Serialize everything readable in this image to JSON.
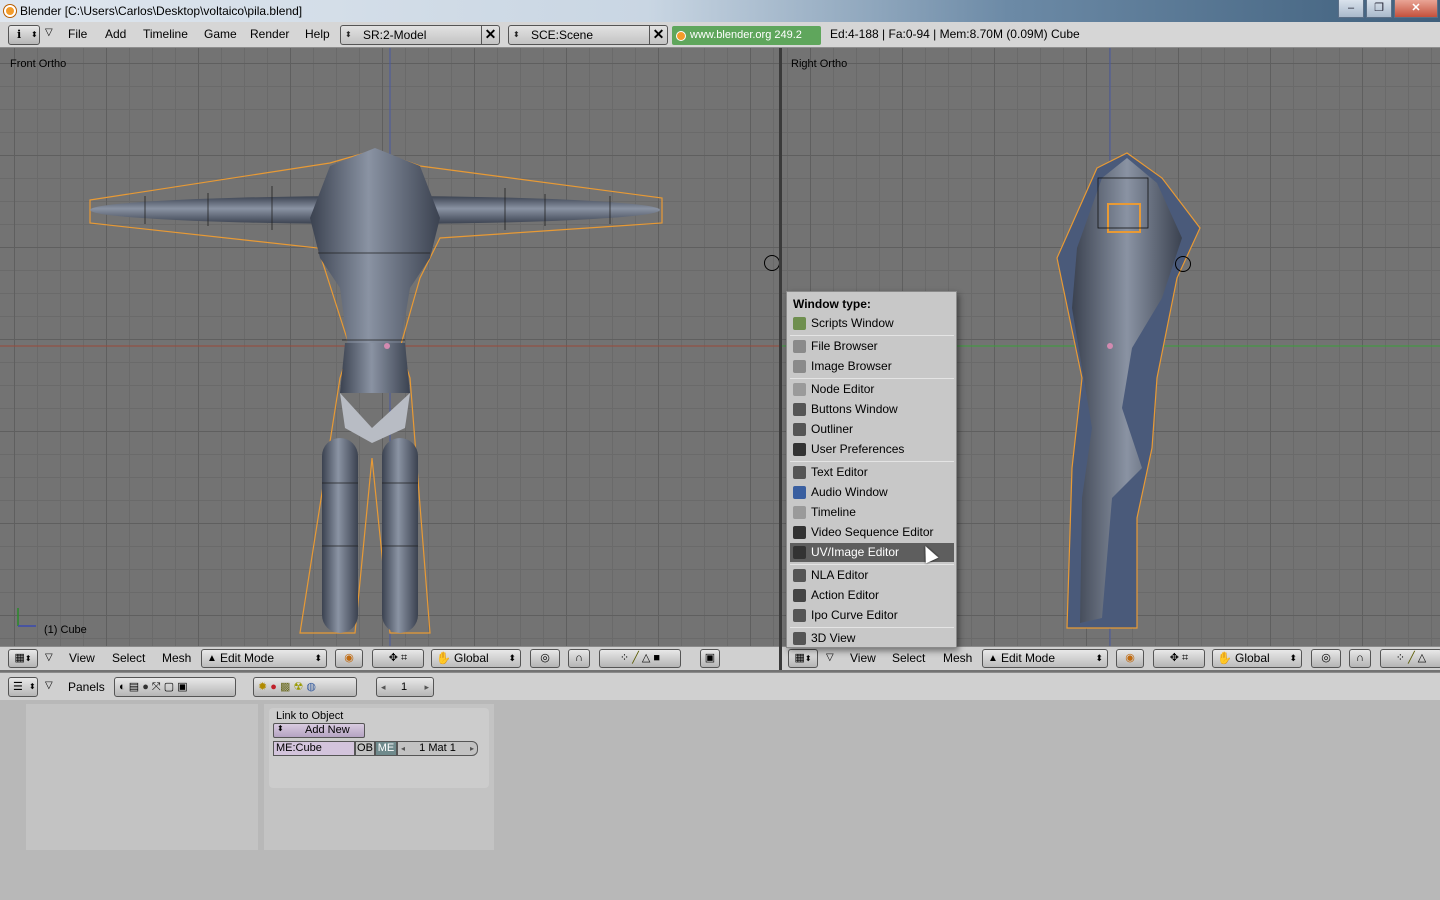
{
  "window": {
    "title": "Blender [C:\\Users\\Carlos\\Desktop\\voltaico\\pila.blend]",
    "controls": [
      "–",
      "❐",
      "✕"
    ]
  },
  "info_header": {
    "menus": [
      "File",
      "Add",
      "Timeline",
      "Game",
      "Render",
      "Help"
    ],
    "screen": "SR:2-Model",
    "scene": "SCE:Scene",
    "url": "www.blender.org 249.2",
    "stats": "Ed:4-188 | Fa:0-94 | Mem:8.70M (0.09M) Cube"
  },
  "viewports": {
    "left": {
      "label": "Front Ortho",
      "object": "(1) Cube"
    },
    "right": {
      "label": "Right Ortho"
    }
  },
  "view3d_header": {
    "menus": [
      "View",
      "Select",
      "Mesh"
    ],
    "mode": "Edit Mode",
    "orientation": "Global"
  },
  "popup": {
    "title": "Window type:",
    "items": [
      {
        "label": "Scripts Window",
        "icon": "scripts-icon",
        "color": "#6f8f4f"
      },
      {
        "label": "File Browser",
        "icon": "file-browser-icon",
        "color": "#8a8a8a"
      },
      {
        "label": "Image Browser",
        "icon": "image-browser-icon",
        "color": "#8a8a8a"
      },
      {
        "label": "Node Editor",
        "icon": "node-editor-icon",
        "color": "#9a9a9a"
      },
      {
        "label": "Buttons Window",
        "icon": "buttons-window-icon",
        "color": "#555555"
      },
      {
        "label": "Outliner",
        "icon": "outliner-icon",
        "color": "#555555"
      },
      {
        "label": "User Preferences",
        "icon": "user-preferences-icon",
        "color": "#333333"
      },
      {
        "label": "Text Editor",
        "icon": "text-editor-icon",
        "color": "#555555"
      },
      {
        "label": "Audio Window",
        "icon": "audio-window-icon",
        "color": "#3a5fa0"
      },
      {
        "label": "Timeline",
        "icon": "timeline-icon",
        "color": "#9a9a9a"
      },
      {
        "label": "Video Sequence Editor",
        "icon": "video-sequence-icon",
        "color": "#333333"
      },
      {
        "label": "UV/Image Editor",
        "icon": "uv-image-editor-icon",
        "color": "#333333"
      },
      {
        "label": "NLA Editor",
        "icon": "nla-editor-icon",
        "color": "#555555"
      },
      {
        "label": "Action Editor",
        "icon": "action-editor-icon",
        "color": "#444444"
      },
      {
        "label": "Ipo Curve Editor",
        "icon": "ipo-curve-icon",
        "color": "#555555"
      },
      {
        "label": "3D View",
        "icon": "3d-view-icon",
        "color": "#555555"
      }
    ],
    "highlighted": "UV/Image Editor"
  },
  "buttons_header": {
    "panels_label": "Panels",
    "frame": "1"
  },
  "link_panel": {
    "title": "Link to Object",
    "add_new": "Add New",
    "mesh_name": "ME:Cube",
    "ob": "OB",
    "me": "ME",
    "mat": "1 Mat 1"
  }
}
